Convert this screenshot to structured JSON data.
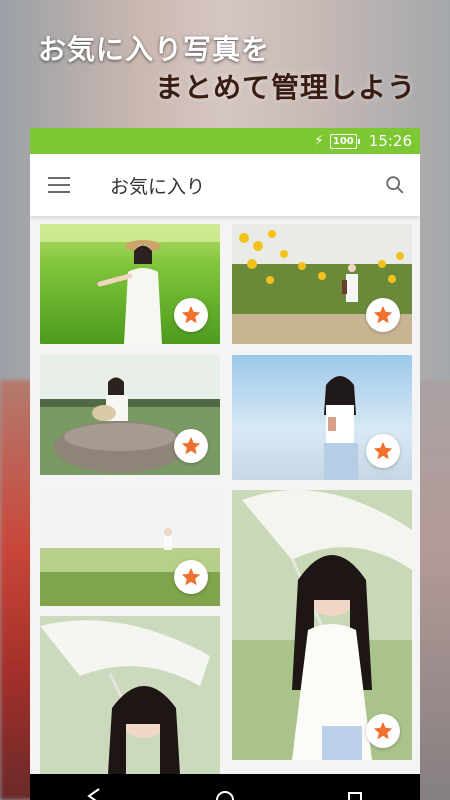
{
  "promo": {
    "line1": "お気に入り写真を",
    "line2": "まとめて管理しよう"
  },
  "status_bar": {
    "battery": "100",
    "time": "15:26",
    "color": "#7cc732"
  },
  "app_bar": {
    "title": "お気に入り",
    "menu_icon": "hamburger-menu-icon",
    "search_icon": "search-icon"
  },
  "photos": [
    {
      "scene": "girl-straw-hat-rice-field",
      "favorited": true
    },
    {
      "scene": "girl-sunflower-field",
      "favorited": true
    },
    {
      "scene": "girl-sitting-on-rock",
      "favorited": true
    },
    {
      "scene": "girl-twin-tails-drink",
      "favorited": true
    },
    {
      "scene": "girl-far-in-meadow",
      "favorited": true
    },
    {
      "scene": "girl-with-parasol-closeup",
      "favorited": true
    },
    {
      "scene": "girl-with-parasol",
      "favorited": false
    }
  ],
  "fav_icon": "star-icon",
  "accent_color": "#f07030",
  "nav": [
    "back-icon",
    "home-icon",
    "recents-icon"
  ]
}
